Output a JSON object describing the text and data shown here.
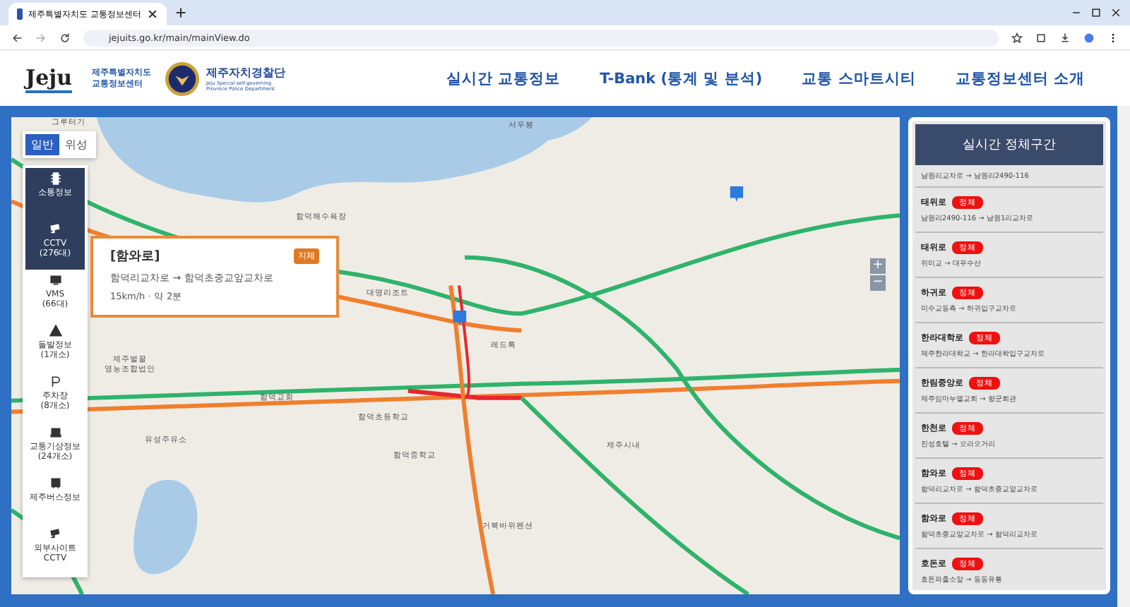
{
  "browser": {
    "tab_title": "제주특별자치도 교통정보센터",
    "url": "jejuits.go.kr/main/mainView.do"
  },
  "header": {
    "logo": "Jeju",
    "org_name": "제주특별자치도\n교통정보센터",
    "police_name": "제주자치경찰단",
    "police_subtitle": "Jeju Special self-governing\nProvince Police Department",
    "nav": [
      "실시간 교통정보",
      "T-Bank (통계 및 분석)",
      "교통 스마트시티",
      "교통정보센터 소개"
    ]
  },
  "map": {
    "view_toggle": [
      {
        "label": "일반",
        "selected": true
      },
      {
        "label": "위성",
        "selected": false
      }
    ],
    "tools": [
      {
        "label": "소통정보",
        "kind": "traffic",
        "selected": true
      },
      {
        "label": "CCTV\n(276대)",
        "kind": "cctv",
        "selected": true
      },
      {
        "label": "VMS\n(66대)",
        "kind": "vms",
        "selected": false
      },
      {
        "label": "돌발정보\n(1개소)",
        "kind": "incident",
        "selected": false
      },
      {
        "label": "주차장\n(8개소)",
        "kind": "parking",
        "selected": false
      },
      {
        "label": "교통기상정보\n(24개소)",
        "kind": "weather",
        "selected": false
      },
      {
        "label": "제주버스정보",
        "kind": "bus",
        "selected": false
      },
      {
        "label": "외부사이트\nCCTV",
        "kind": "cctv",
        "selected": false
      }
    ],
    "labels": [
      {
        "text": "그루터기"
      },
      {
        "text": "서우봉"
      },
      {
        "text": "함덕해수욕장"
      },
      {
        "text": "대명리조트"
      },
      {
        "text": "함덕교회"
      },
      {
        "text": "함덕초등학교"
      },
      {
        "text": "함덕중학교"
      },
      {
        "text": "유성주유소"
      },
      {
        "text": "제주벌꿀\n영농조합법인"
      },
      {
        "text": "레드톡"
      },
      {
        "text": "제주시내"
      },
      {
        "text": "거북바위펜션"
      }
    ],
    "popup": {
      "road": "[함와로]",
      "status": "지체",
      "route": "함덕리교차로 → 함덕초중교앞교차로",
      "meta": "15km/h · 약 2분"
    },
    "zoom": [
      "+",
      "−"
    ]
  },
  "panel": {
    "title": "실시간 정체구간",
    "items": [
      {
        "route": "남원리교차로 → 남원리2490-116"
      },
      {
        "road": "태위로",
        "status": "정체",
        "route": "남원리2490-116 → 남원1리교차로"
      },
      {
        "road": "태위로",
        "status": "정체",
        "route": "위미교 → 대우수산"
      },
      {
        "road": "하귀로",
        "status": "정체",
        "route": "미수교동측 → 하귀입구교차로"
      },
      {
        "road": "한라대학로",
        "status": "정체",
        "route": "제주한라대학교 → 한라대학입구교차로"
      },
      {
        "road": "한림중앙로",
        "status": "정체",
        "route": "제주임마누엘교회 → 향군회관"
      },
      {
        "road": "한천로",
        "status": "정체",
        "route": "진성호텔 → 오라오거리"
      },
      {
        "road": "함와로",
        "status": "정체",
        "route": "함덕리교차로 → 함덕초중교앞교차로"
      },
      {
        "road": "함와로",
        "status": "정체",
        "route": "함덕초중교앞교차로 → 함덕리교차로"
      },
      {
        "road": "호돈로",
        "status": "정체",
        "route": "호돈파출소앞 → 동동유통"
      }
    ]
  }
}
